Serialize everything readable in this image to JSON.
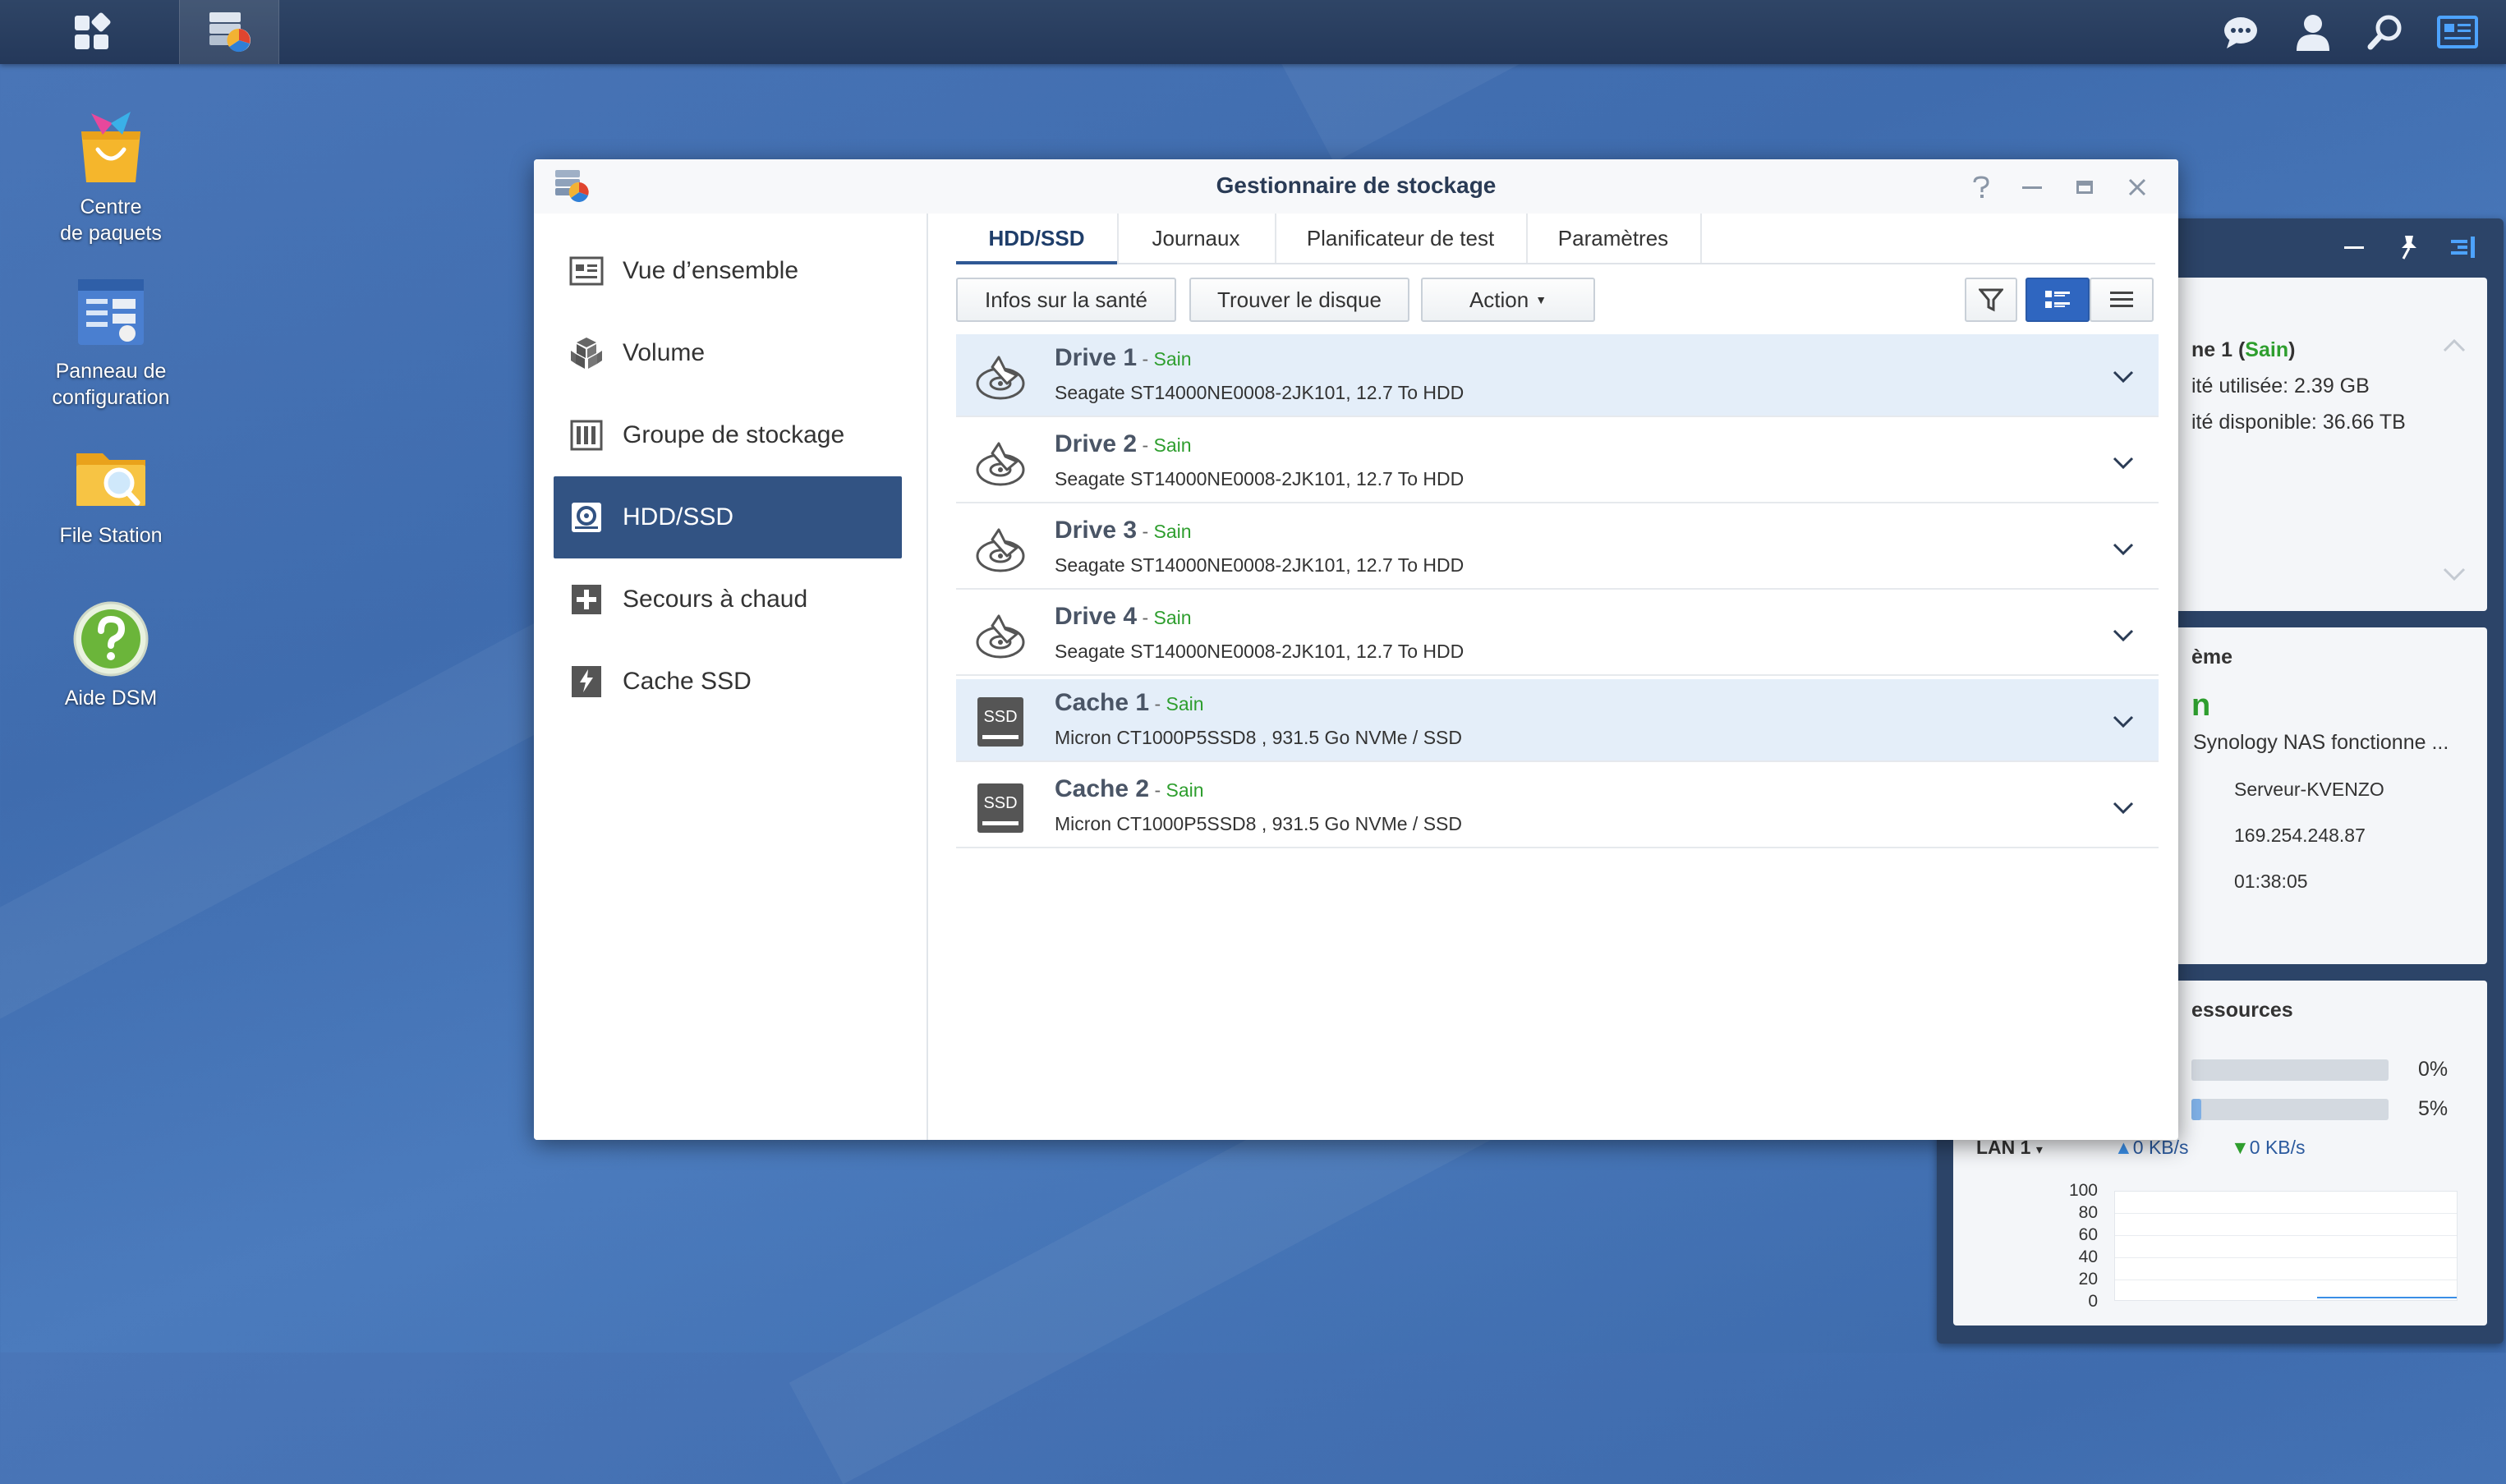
{
  "desktop": {
    "icons": [
      {
        "label_line1": "Centre",
        "label_line2": "de paquets",
        "icon": "package-center-icon"
      },
      {
        "label_line1": "Panneau de",
        "label_line2": "configuration",
        "icon": "control-panel-icon"
      },
      {
        "label_line1": "File Station",
        "label_line2": "",
        "icon": "file-station-icon"
      },
      {
        "label_line1": "Aide DSM",
        "label_line2": "",
        "icon": "dsm-help-icon"
      }
    ]
  },
  "widgets": {
    "storage": {
      "title": "ne 1 (",
      "status": "Sain",
      "title_end": ")",
      "used": "ité utilisée: 2.39 GB",
      "free": "ité disponible: 36.66 TB"
    },
    "system": {
      "title": "ème",
      "status_glyph": "n",
      "message": "Synology NAS fonctionne ...",
      "server_name": "Serveur-KVENZO",
      "ip": "169.254.248.87",
      "uptime": "01:38:05"
    },
    "resources": {
      "title": "essources",
      "cpu_pct": "0%",
      "ram_pct": "5%",
      "cpu_level": 0,
      "ram_level": 5,
      "lan_label": "LAN 1",
      "up_speed": "0 KB/s",
      "down_speed": "0 KB/s",
      "y_ticks": [
        "100",
        "80",
        "60",
        "40",
        "20",
        "0"
      ]
    }
  },
  "window": {
    "title": "Gestionnaire de stockage",
    "sidebar": [
      {
        "label": "Vue d’ensemble",
        "icon": "overview-icon",
        "active": false
      },
      {
        "label": "Volume",
        "icon": "volume-icon",
        "active": false
      },
      {
        "label": "Groupe de stockage",
        "icon": "storage-pool-icon",
        "active": false
      },
      {
        "label": "HDD/SSD",
        "icon": "hdd-ssd-icon",
        "active": true
      },
      {
        "label": "Secours à chaud",
        "icon": "hot-spare-icon",
        "active": false
      },
      {
        "label": "Cache SSD",
        "icon": "ssd-cache-icon",
        "active": false
      }
    ],
    "tabs": [
      "HDD/SSD",
      "Journaux",
      "Planificateur de test",
      "Paramètres"
    ],
    "toolbar": {
      "health_info": "Infos sur la santé",
      "find_disk": "Trouver le disque",
      "action": "Action"
    },
    "drives": [
      {
        "name": "Drive 1",
        "status": "Sain",
        "desc": "Seagate ST14000NE0008-2JK101, 12.7 To HDD",
        "kind": "hdd"
      },
      {
        "name": "Drive 2",
        "status": "Sain",
        "desc": "Seagate ST14000NE0008-2JK101, 12.7 To HDD",
        "kind": "hdd"
      },
      {
        "name": "Drive 3",
        "status": "Sain",
        "desc": "Seagate ST14000NE0008-2JK101, 12.7 To HDD",
        "kind": "hdd"
      },
      {
        "name": "Drive 4",
        "status": "Sain",
        "desc": "Seagate ST14000NE0008-2JK101, 12.7 To HDD",
        "kind": "hdd"
      },
      {
        "name": "Cache 1",
        "status": "Sain",
        "desc": "Micron CT1000P5SSD8 , 931.5 Go NVMe / SSD",
        "kind": "ssd"
      },
      {
        "name": "Cache 2",
        "status": "Sain",
        "desc": "Micron CT1000P5SSD8 , 931.5 Go NVMe / SSD",
        "kind": "ssd"
      }
    ],
    "ssd_badge": "SSD"
  },
  "colors": {
    "accent": "#325383",
    "healthy": "#2e9e2e",
    "selected_view": "#2f66c0"
  }
}
